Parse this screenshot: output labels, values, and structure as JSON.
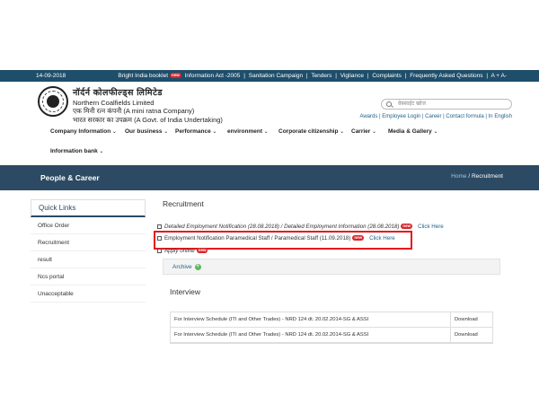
{
  "topbar": {
    "date": "14-09-2018",
    "links": [
      "Bright India booklet",
      "Information Act -2005",
      "Sanitation Campaign",
      "Tenders",
      "Vigliance",
      "Complaints",
      "Frequently Asked Questions",
      "A + A-"
    ],
    "new_badge": "new"
  },
  "header": {
    "org_hindi": "नॉर्दर्न कोलफील्ड्स  लिमिटेड",
    "org_english": "Northern Coalfields Limited",
    "org_line3": "एक मिनी रत्न कंपनी (A mini ratna Company)",
    "org_line4": "भारत सरकार का उपक्रम (A Govt. of India Undertaking)",
    "search_placeholder": "वेबसाईट खोज",
    "utility_links": "Awards | Employee Login | Career | Contact formula | In English"
  },
  "nav": [
    {
      "label": "Company Information"
    },
    {
      "label": "Our business"
    },
    {
      "label": "Performance"
    },
    {
      "label": "environment"
    },
    {
      "label": "Corporate citizenship"
    },
    {
      "label": "Carrier"
    },
    {
      "label": "Media & Gallery"
    },
    {
      "label": "Information bank"
    }
  ],
  "band": {
    "title": "People & Career",
    "crumb_home": "Home",
    "crumb_sep": "/",
    "crumb_current": "Recruitment"
  },
  "sidebar": {
    "heading": "Quick Links",
    "items": [
      "Office Order",
      "Recruitment",
      "result",
      "Ncs portal",
      "Unacceptable"
    ]
  },
  "main": {
    "title": "Recruitment",
    "notifications": [
      {
        "text": "Detailed Employment Notification (28.08.2018) / Detailed Employment Information (28.08.2018)",
        "link": "Click Here"
      },
      {
        "text": "Employment Notification Paramedical Staff / Paramedical Staff (11.09.2018)",
        "link": "Click Here"
      },
      {
        "text": "Apply online",
        "link": ""
      }
    ],
    "archive": "Archive",
    "interview_title": "Interview",
    "table": [
      {
        "desc": "For Interview Schedule (ITI and Other Trades) - NRD 124 dt. 20.02.2014-SG & ASSI",
        "action": "Download"
      },
      {
        "desc": "For Interview Schedule (ITI and Other Trades) - NRD 124 dt. 20.02.2014-SG & ASSI",
        "action": "Download"
      }
    ]
  }
}
